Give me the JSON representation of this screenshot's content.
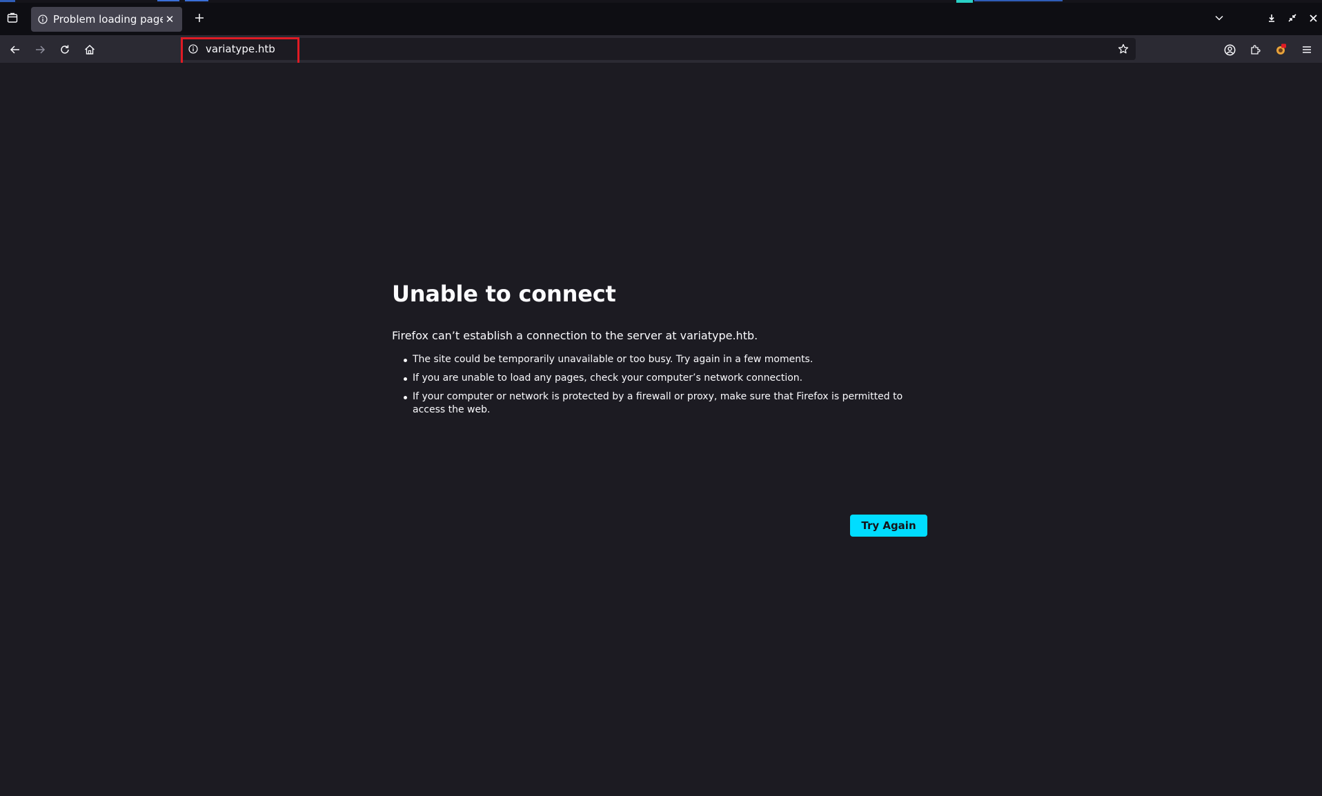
{
  "tab": {
    "title": "Problem loading page",
    "icon": "info-icon",
    "close_glyph": "✕"
  },
  "newtab": {
    "glyph": "+"
  },
  "urlbar": {
    "url": "variatype.htb",
    "info_icon": "info-icon",
    "bookmark_icon": "star-icon"
  },
  "error": {
    "title": "Unable to connect",
    "description": "Firefox can’t establish a connection to the server at variatype.htb.",
    "items": [
      "The site could be temporarily unavailable or too busy. Try again in a few moments.",
      "If you are unable to load any pages, check your computer’s network connection.",
      "If your computer or network is protected by a firewall or proxy, make sure that Firefox is permitted to access the web."
    ],
    "button_label": "Try Again"
  },
  "colors": {
    "accent": "#00ddff",
    "highlight": "#e01b24",
    "background": "#1c1b22",
    "toolbar": "#2b2a33"
  }
}
